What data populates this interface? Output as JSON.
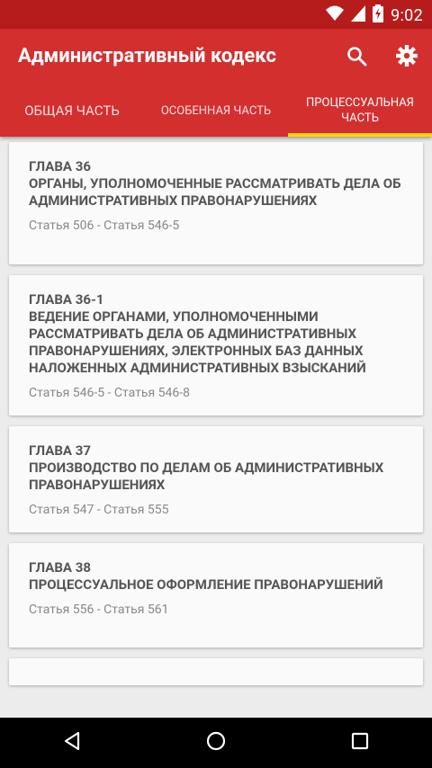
{
  "status_bar": {
    "time": "9:02"
  },
  "app_bar": {
    "title": "Административный кодекс",
    "search_icon": "search-icon",
    "settings_icon": "gear-icon"
  },
  "tabs": [
    {
      "label": "ОБЩАЯ ЧАСТЬ",
      "active": false
    },
    {
      "label": "ОСОБЕННАЯ ЧАСТЬ",
      "active": false
    },
    {
      "label": "ПРОЦЕССУАЛЬНАЯ ЧАСТЬ",
      "active": true
    }
  ],
  "chapters": [
    {
      "title": "ГЛАВА 36\n ОРГАНЫ, УПОЛНОМОЧЕННЫЕ РАССМАТРИВАТЬ ДЕЛА ОБ АДМИНИСТРАТИВНЫХ ПРАВОНАРУШЕНИЯХ",
      "articles": "Статья 506 - Статья 546-5"
    },
    {
      "title": "ГЛАВА 36-1\n ВЕДЕНИЕ ОРГАНАМИ, УПОЛНОМОЧЕННЫМИ РАССМАТРИВАТЬ ДЕЛА ОБ АДМИНИСТРАТИВНЫХ ПРАВОНАРУШЕНИЯХ, ЭЛЕКТРОННЫХ БАЗ ДАННЫХ НАЛОЖЕННЫХ АДМИНИСТРАТИВНЫХ ВЗЫСКАНИЙ",
      "articles": "Статья 546-5 - Статья 546-8"
    },
    {
      "title": "ГЛАВА 37\n ПРОИЗВОДСТВО ПО ДЕЛАМ ОБ АДМИНИСТРАТИВНЫХ ПРАВОНАРУШЕНИЯХ",
      "articles": "Статья 547 - Статья 555"
    },
    {
      "title": "ГЛАВА 38\n ПРОЦЕССУАЛЬНОЕ ОФОРМЛЕНИЕ ПРАВОНАРУШЕНИЙ",
      "articles": "Статья 556 - Статья 561"
    }
  ],
  "nav_bar": {
    "back_icon": "back-icon",
    "home_icon": "home-icon",
    "recents_icon": "recents-icon"
  }
}
